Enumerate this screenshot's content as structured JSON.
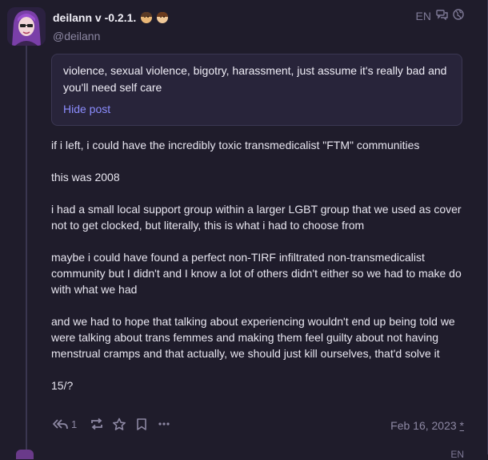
{
  "post": {
    "display_name": "deilann v -0.2.1.",
    "handle": "@deilann",
    "language": "EN",
    "content_warning": "violence, sexual violence, bigotry, harassment, just assume it's really bad and you'll need self care",
    "hide_label": "Hide post",
    "paragraphs": [
      "if i left, i could have the incredibly toxic transmedicalist \"FTM\" communities",
      "this was 2008",
      "i had a small local support group within a larger LGBT group that we used as cover not to get clocked, but literally, this is what i had to choose from",
      "maybe i could have found a perfect non-TIRF infiltrated non-transmedicalist community but I didn't and I know a lot of others didn't either so we had to make do with what we had",
      "and we had to hope that talking about experiencing wouldn't end up being told we were talking about trans femmes and making them feel guilty about not having menstrual cramps and that actually, we should just kill ourselves, that'd solve it",
      "15/?"
    ],
    "reply_count": "1",
    "date": "Feb 16, 2023",
    "edited_marker": "*"
  },
  "icons": {
    "thread": "thread-icon",
    "globe": "globe-icon",
    "reply": "reply-all-icon",
    "boost": "boost-icon",
    "favourite": "star-icon",
    "bookmark": "bookmark-icon",
    "more": "more-icon"
  },
  "colors": {
    "background": "#1f1c2b",
    "cw_box": "#28243a",
    "link": "#8c8dff",
    "muted": "#8d88a3"
  },
  "next_post": {
    "language": "EN"
  }
}
